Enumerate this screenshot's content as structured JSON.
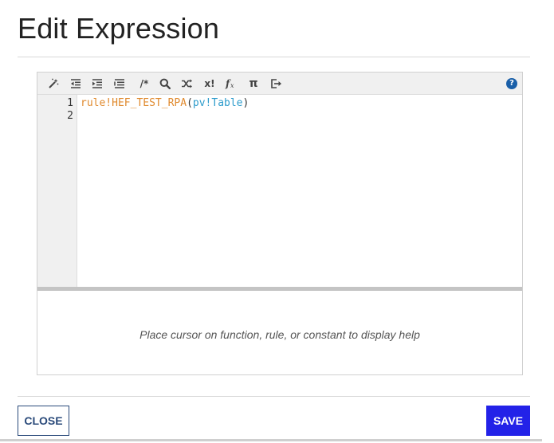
{
  "dialog": {
    "title": "Edit Expression"
  },
  "toolbar": {
    "buttons": [
      {
        "icon": "magic-wand-icon",
        "label": "Format"
      },
      {
        "icon": "outdent-icon",
        "label": "Outdent"
      },
      {
        "icon": "indent-icon",
        "label": "Indent"
      },
      {
        "icon": "auto-indent-icon",
        "label": "Auto indent"
      },
      {
        "icon": "comment-icon",
        "label": "/*"
      },
      {
        "icon": "search-icon",
        "label": "Find"
      },
      {
        "icon": "shuffle-icon",
        "label": "Replace"
      },
      {
        "icon": "rule-icon",
        "label": "x!"
      },
      {
        "icon": "function-icon",
        "label": "f(x)"
      },
      {
        "icon": "pi-icon",
        "label": "π"
      },
      {
        "icon": "export-icon",
        "label": "Export"
      }
    ],
    "help_icon": "help-circle-icon",
    "help_label": "?"
  },
  "editor": {
    "line_numbers": [
      "1",
      "2"
    ],
    "line1": {
      "rule_token": "rule!HEF_TEST_RPA",
      "open_paren": "(",
      "var_token": "pv!Table",
      "close_paren": ")"
    },
    "line2": ""
  },
  "help_panel": {
    "text": "Place cursor on function, rule, or constant to display help"
  },
  "actions": {
    "close_label": "CLOSE",
    "save_label": "SAVE"
  },
  "colors": {
    "rule_token": "#e08a2e",
    "var_token": "#2e9ccc",
    "save_button": "#2322e8",
    "close_border": "#2a4a7a",
    "help_icon": "#1a5fa8"
  }
}
